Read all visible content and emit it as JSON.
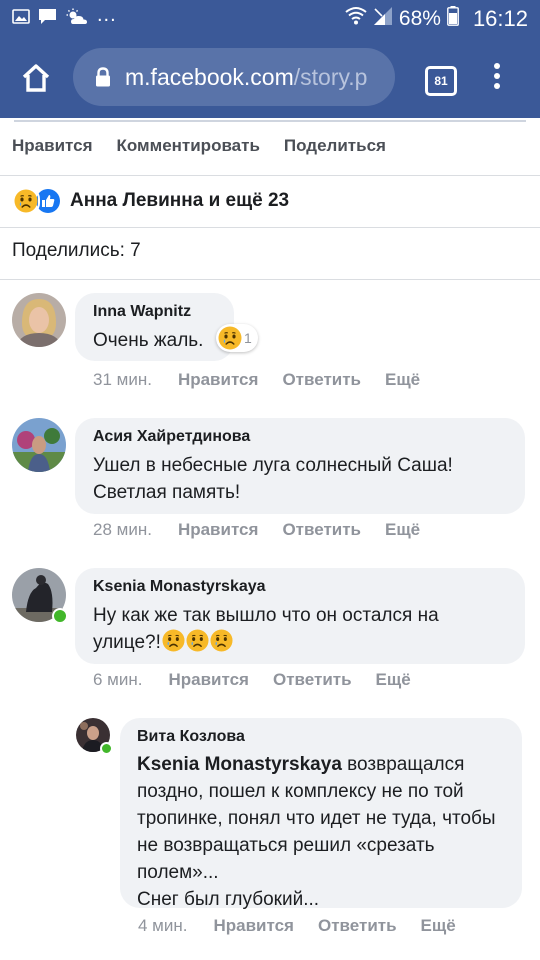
{
  "status_bar": {
    "wifi_icon": "wifi-icon",
    "battery_percent": "68%",
    "time": "16:12",
    "notification_icons": [
      "gallery-icon",
      "chat-icon",
      "weather-icon"
    ],
    "more_indicator": "..."
  },
  "browser": {
    "url_main": "m.facebook.com",
    "url_path": "/story.p",
    "tab_count": "81",
    "home_icon": "home-icon",
    "lock_icon": "lock-icon",
    "menu_icon": "kebab-menu-icon"
  },
  "post_actions": {
    "like": "Нравится",
    "comment": "Комментировать",
    "share": "Поделиться"
  },
  "reactions": {
    "summary": "Анна Левинна и ещё 23",
    "icons": [
      "sad-reaction-icon",
      "like-reaction-icon"
    ]
  },
  "shares_text": "Поделились: 7",
  "comments": [
    {
      "author": "Inna Wapnitz",
      "text": "Очень жаль.",
      "reaction_count": "1",
      "time": "31 мин.",
      "like": "Нравится",
      "reply": "Ответить",
      "more": "Ещё",
      "online": false
    },
    {
      "author": "Асия Хайретдинова",
      "text": "Ушел в небесные луга солнесный Саша! Светлая память!",
      "time": "28 мин.",
      "like": "Нравится",
      "reply": "Ответить",
      "more": "Ещё",
      "online": false
    },
    {
      "author": "Ksenia Monastyrskaya",
      "text": "Ну как же так вышло что он остался на улице?!",
      "time": "6 мин.",
      "like": "Нравится",
      "reply": "Ответить",
      "more": "Ещё",
      "online": true
    }
  ],
  "reply": {
    "author": "Вита Козлова",
    "mention": "Ksenia Monastyrskaya",
    "text": " возвращался поздно, пошел к комплексу не по той тропинке, понял что идет не туда, чтобы не возвращаться решил «срезать полем»...",
    "text2": "Снег был глубокий...",
    "time": "4 мин.",
    "like": "Нравится",
    "reply": "Ответить",
    "more": "Ещё",
    "online": true
  },
  "colors": {
    "facebook_blue": "#3b5998",
    "url_box": "#5973a9",
    "bubble": "#f0f2f5",
    "meta_grey": "#90949c",
    "online_green": "#42b72a",
    "like_blue": "#1877f2",
    "sad_yellow": "#f7b928"
  }
}
